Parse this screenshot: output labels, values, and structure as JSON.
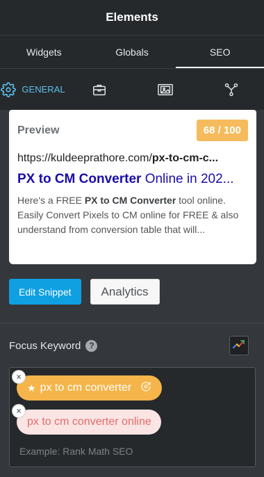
{
  "header": {
    "title": "Elements"
  },
  "tabs": [
    {
      "label": "Widgets"
    },
    {
      "label": "Globals"
    },
    {
      "label": "SEO"
    }
  ],
  "subtabs": [
    {
      "label": "GENERAL",
      "icon": "gear-icon"
    },
    {
      "icon": "toolbox-icon"
    },
    {
      "icon": "image-frame-icon"
    },
    {
      "icon": "schema-icon"
    }
  ],
  "preview": {
    "label": "Preview",
    "score": "68 / 100",
    "url_base": "https://kuldeeprathore.com/",
    "url_slug": "px-to-cm-c...",
    "title_bold": "PX to CM Converter",
    "title_rest": " Online in 202...",
    "desc_1": "Here's a FREE ",
    "desc_bold": "PX to CM Converter",
    "desc_2": " tool online. Easily Convert Pixels to CM online for FREE & also understand from conversion table that will..."
  },
  "actions": {
    "edit_snippet": "Edit Snippet",
    "analytics": "Analytics"
  },
  "focus_keyword": {
    "label": "Focus Keyword",
    "help": "?",
    "keywords": [
      "px to cm converter",
      "px to cm converter online"
    ],
    "placeholder": "Example: Rank Math SEO"
  },
  "colors": {
    "accent": "#5bc0eb",
    "primary_button": "#0fa0e2",
    "score_badge": "#f5bb5c",
    "primary_pill": "#f5b54a",
    "secondary_pill": "#fbe4e4"
  }
}
